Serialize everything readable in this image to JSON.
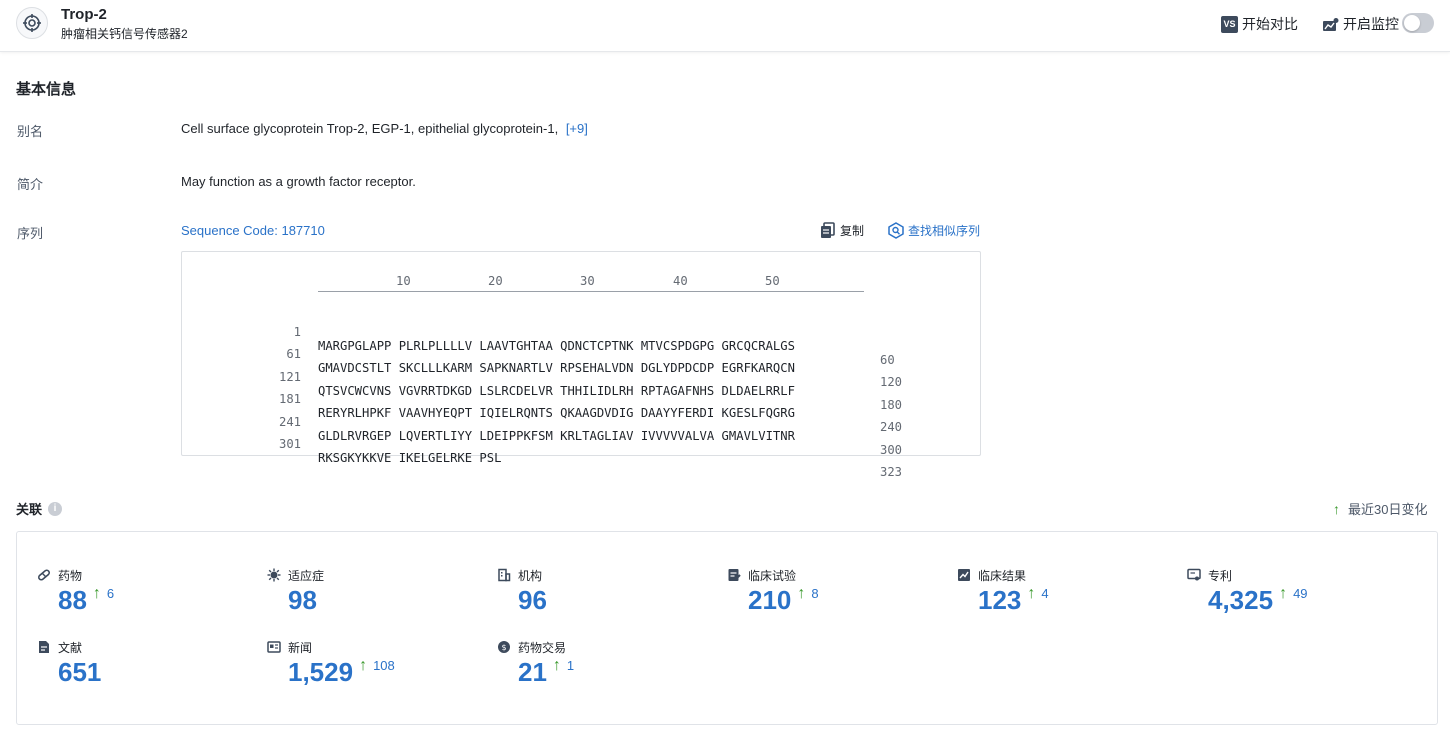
{
  "header": {
    "title": "Trop-2",
    "subtitle": "肿瘤相关钙信号传感器2",
    "compare_badge": "VS",
    "compare_label": "开始对比",
    "monitor_label": "开启监控",
    "monitor_on": false
  },
  "basic": {
    "section_title": "基本信息",
    "alias_label": "别名",
    "alias_value": "Cell surface glycoprotein Trop-2,  EGP-1,  epithelial glycoprotein-1,",
    "alias_more": "[+9]",
    "intro_label": "简介",
    "intro_value": "May function as a growth factor receptor.",
    "seq_label": "序列",
    "seq_code": "Sequence Code: 187710",
    "copy_label": "复制",
    "find_label": "查找相似序列"
  },
  "sequence": {
    "ruler": [
      "10",
      "20",
      "30",
      "40",
      "50"
    ],
    "rows": [
      {
        "start": "1",
        "residues": "MARGPGLAPP PLRLPLLLLV LAAVTGHTAA QDNCTCPTNK MTVCSPDGPG GRCQCRALGS",
        "end": "60"
      },
      {
        "start": "61",
        "residues": "GMAVDCSTLT SKCLLLKARM SAPKNARTLV RPSEHALVDN DGLYDPDCDP EGRFKARQCN",
        "end": "120"
      },
      {
        "start": "121",
        "residues": "QTSVCWCVNS VGVRRTDKGD LSLRCDELVR THHILIDLRH RPTAGAFNHS DLDAELRRLF",
        "end": "180"
      },
      {
        "start": "181",
        "residues": "RERYRLHPKF VAAVHYEQPT IQIELRQNTS QKAAGDVDIG DAAYYFERDI KGESLFQGRG",
        "end": "240"
      },
      {
        "start": "241",
        "residues": "GLDLRVRGEP LQVERTLIYY LDEIPPKFSM KRLTAGLIAV IVVVVVALVA GMAVLVITNR",
        "end": "300"
      },
      {
        "start": "301",
        "residues": "RKSGKYKKVE IKELGELRKE PSL",
        "end": "323"
      }
    ]
  },
  "relations": {
    "title": "关联",
    "info_glyph": "i",
    "recent_label": "最近30日变化",
    "accent_color": "#2a72c8",
    "up_color": "#3c9a2e",
    "items": [
      {
        "label": "药物",
        "value": "88",
        "delta": "6",
        "icon": "pill-icon"
      },
      {
        "label": "适应症",
        "value": "98",
        "delta": "",
        "icon": "virus-icon"
      },
      {
        "label": "机构",
        "value": "96",
        "delta": "",
        "icon": "building-icon"
      },
      {
        "label": "临床试验",
        "value": "210",
        "delta": "8",
        "icon": "clipboard-icon"
      },
      {
        "label": "临床结果",
        "value": "123",
        "delta": "4",
        "icon": "chart-report-icon"
      },
      {
        "label": "专利",
        "value": "4,325",
        "delta": "49",
        "icon": "patent-icon"
      },
      {
        "label": "文献",
        "value": "651",
        "delta": "",
        "icon": "document-icon"
      },
      {
        "label": "新闻",
        "value": "1,529",
        "delta": "108",
        "icon": "newspaper-icon"
      },
      {
        "label": "药物交易",
        "value": "21",
        "delta": "1",
        "icon": "deal-icon"
      }
    ]
  }
}
